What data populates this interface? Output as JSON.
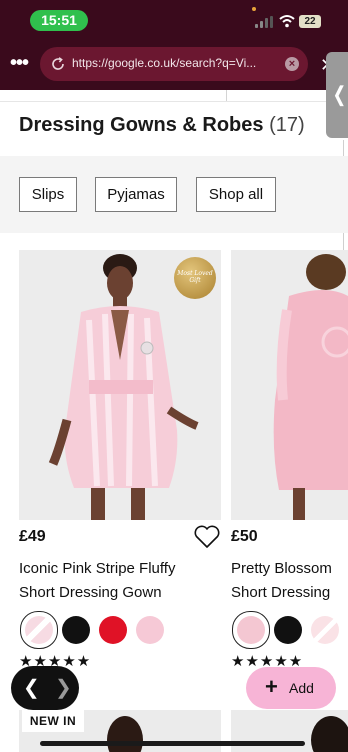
{
  "status_bar": {
    "time": "15:51",
    "battery": "22"
  },
  "browser": {
    "url": "https://google.co.uk/search?q=Vi..."
  },
  "page": {
    "title": "Dressing Gowns & Robes",
    "count": "(17)"
  },
  "filters": [
    "Slips",
    "Pyjamas",
    "Shop all"
  ],
  "products": [
    {
      "price": "£49",
      "name_line1": "Iconic Pink Stripe Fluffy",
      "name_line2": "Short Dressing Gown",
      "badge_line1": "Most Loved",
      "badge_line2": "Gift",
      "swatches": [
        "#f7dbe3",
        "#111111",
        "#e01226",
        "#f6c9d6"
      ],
      "stars": "★★★★★"
    },
    {
      "price": "£50",
      "name_line1": "Pretty Blossom",
      "name_line2": "Short Dressing",
      "swatches": [
        "#f4c7d2",
        "#111111",
        "#fae2e6"
      ],
      "stars": "★★★★★"
    }
  ],
  "controls": {
    "add_label": "Add",
    "add_icon": "plus-icon"
  },
  "new_in": "NEW IN",
  "colors": {
    "browser_bg": "#3a0a1c",
    "url_pill": "#6b1730",
    "accent_pink": "#f7b4d6",
    "clock_green": "#30c04d"
  }
}
